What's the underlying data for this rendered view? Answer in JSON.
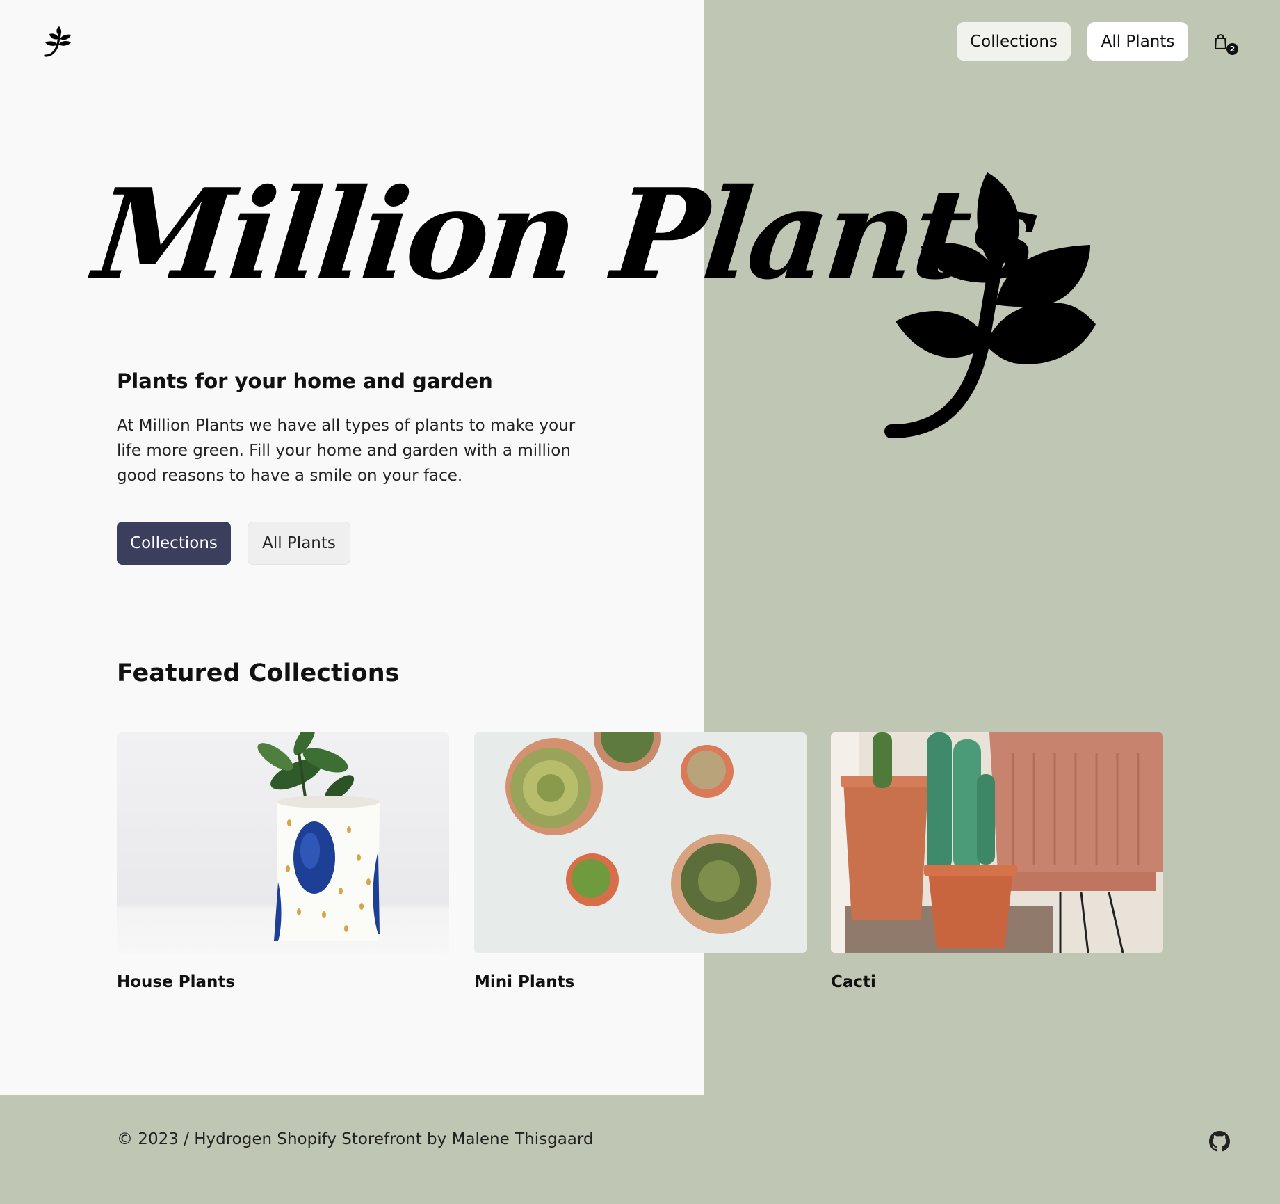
{
  "brand": {
    "logo_icon": "leaf-sprig-icon"
  },
  "header": {
    "nav": [
      {
        "label": "Collections"
      },
      {
        "label": "All Plants"
      }
    ],
    "cart": {
      "icon": "shopping-bag-icon",
      "count": "2"
    }
  },
  "hero": {
    "title": "Million Plants",
    "subtitle": "Plants for your home and garden",
    "text": "At Million Plants we have all types of plants to make your life more green. Fill your home and garden with a million good reasons to have a smile on your face.",
    "buttons": [
      {
        "label": "Collections"
      },
      {
        "label": "All Plants"
      }
    ]
  },
  "featured": {
    "title": "Featured Collections",
    "items": [
      {
        "title": "House Plants"
      },
      {
        "title": "Mini Plants"
      },
      {
        "title": "Cacti"
      }
    ]
  },
  "footer": {
    "text": "© 2023 / Hydrogen Shopify Storefront by Malene Thisgaard",
    "icon": "github-icon"
  },
  "colors": {
    "background": "#f9f9f9",
    "accent_panel": "#bfc6b3",
    "primary_button": "#3b3f5d"
  }
}
